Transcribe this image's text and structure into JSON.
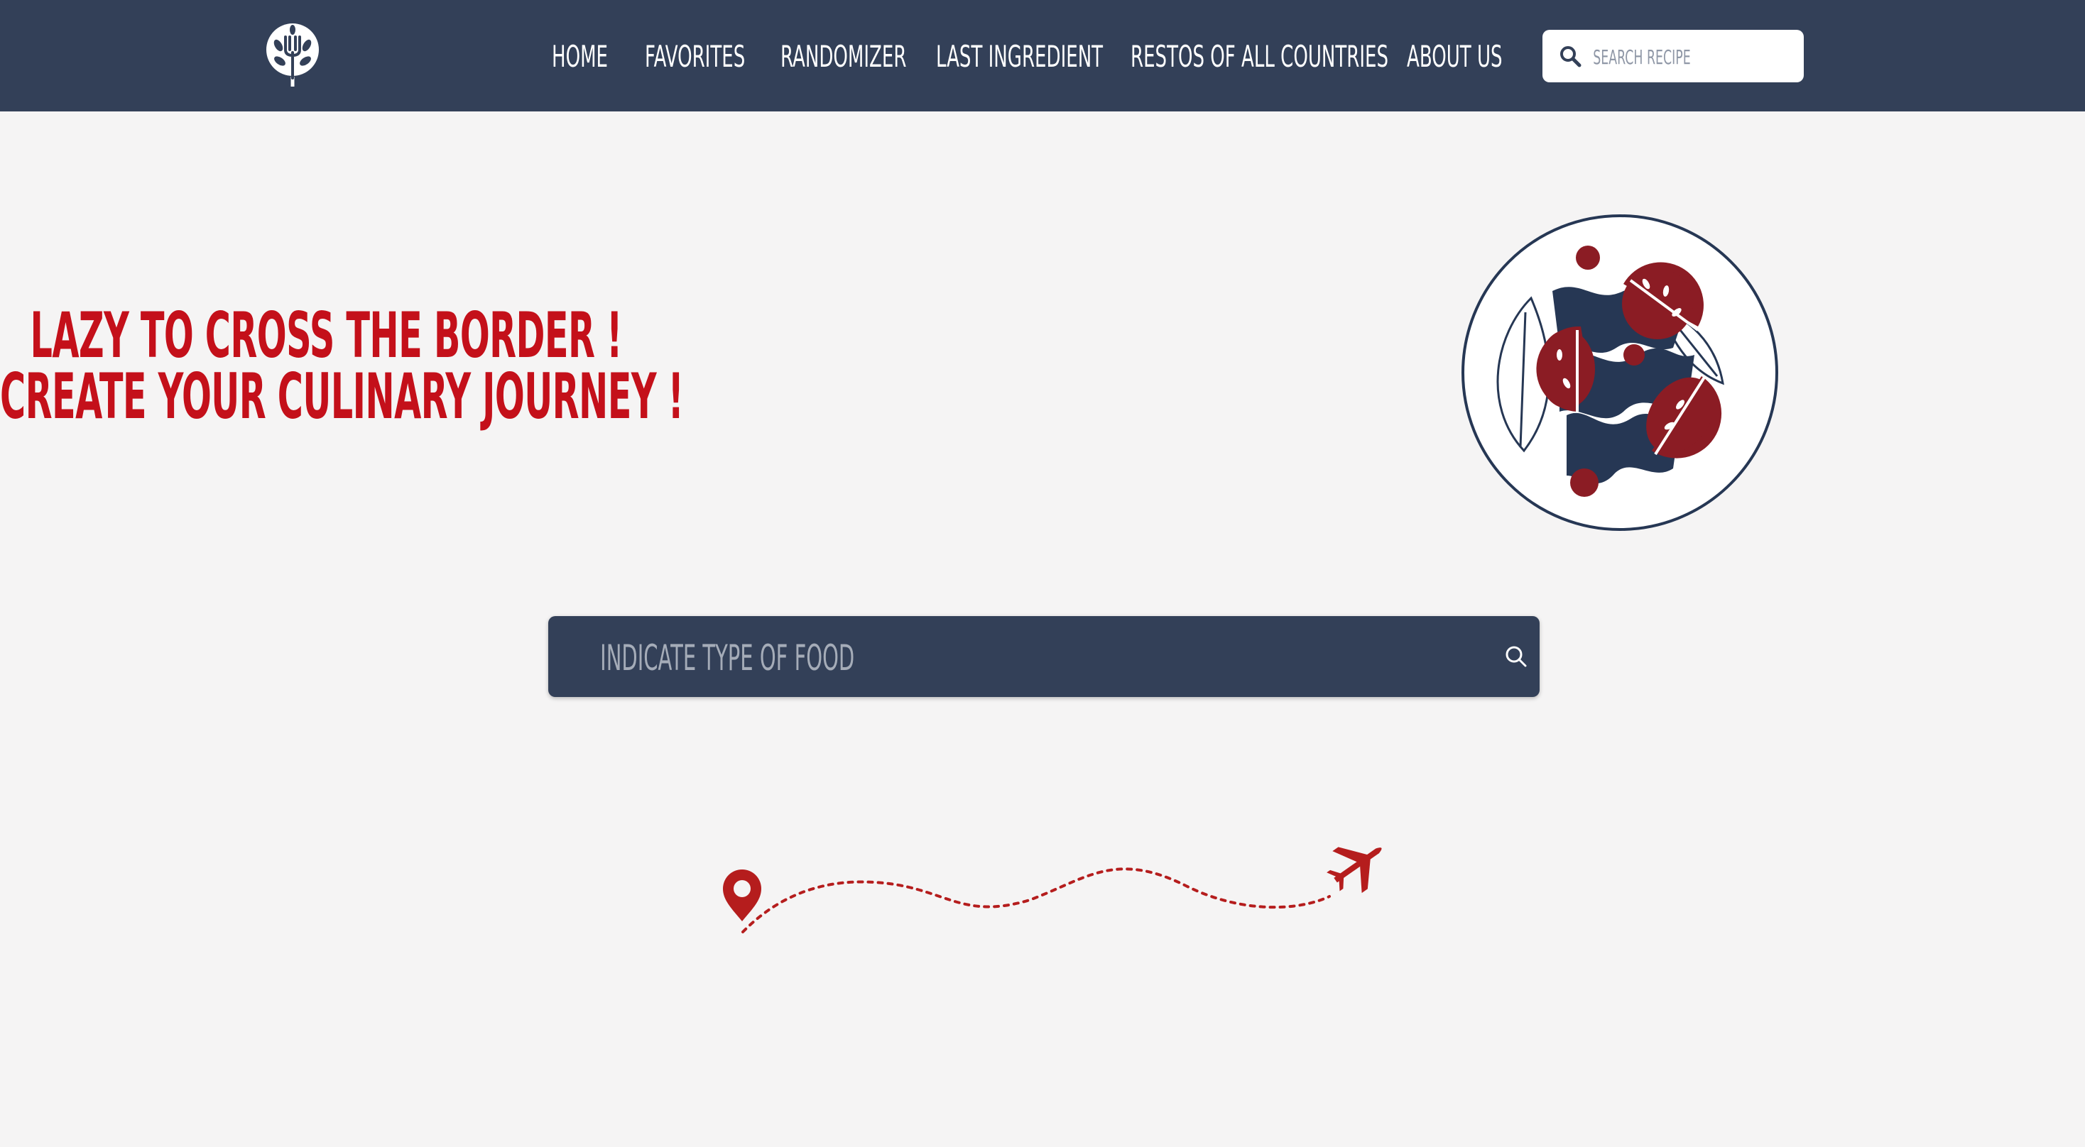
{
  "nav": {
    "links": [
      {
        "label": "HOME"
      },
      {
        "label": "FAVORITES"
      },
      {
        "label": "RANDOMIZER"
      },
      {
        "label": "LAST INGREDIENT"
      },
      {
        "label": "RESTOS OF ALL COUNTRIES"
      },
      {
        "label": "ABOUT US"
      }
    ],
    "search": {
      "placeholder": "SEARCH RECIPE",
      "icon": "search-icon"
    },
    "logo": {
      "icon": "tree-fork-logo-icon"
    }
  },
  "hero": {
    "line1": "LAZY TO CROSS THE BORDER !",
    "line2": "CREATE YOUR CULINARY JOURNEY !",
    "illustration": "salad-plate-icon"
  },
  "food_search": {
    "placeholder": "INDICATE TYPE OF FOOD",
    "icon": "search-icon"
  },
  "journey": {
    "start_icon": "map-pin-icon",
    "end_icon": "airplane-icon"
  },
  "colors": {
    "navbar": "#334058",
    "accent_red": "#c4101a",
    "plate_red": "#8b1c24",
    "background": "#f5f4f4"
  }
}
